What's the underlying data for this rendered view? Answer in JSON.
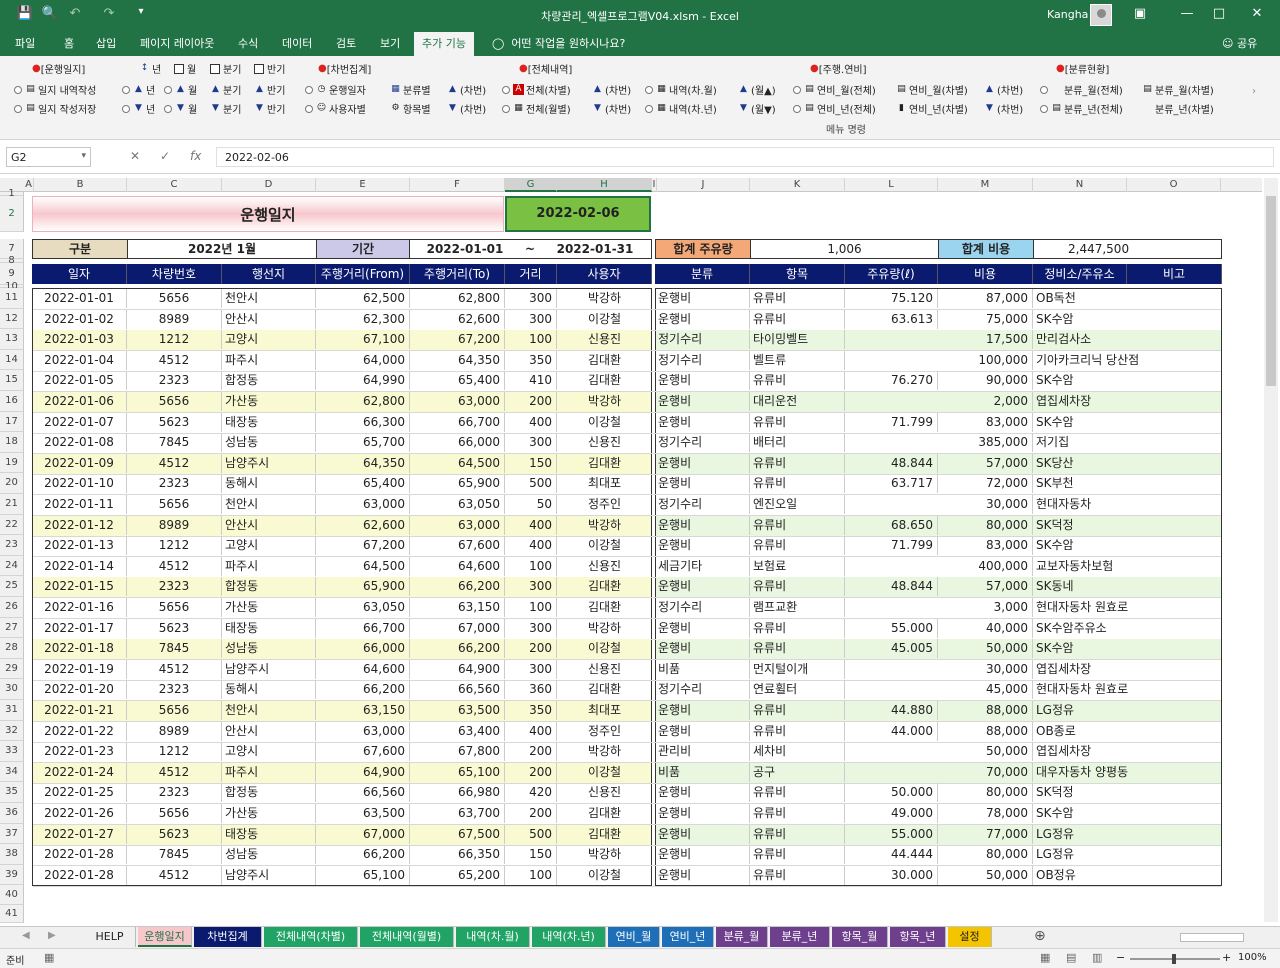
{
  "window": {
    "title": "차량관리_엑셀프로그램V04.xlsm  -  Excel",
    "user": "Kangha"
  },
  "tabs": [
    "파일",
    "홈",
    "삽입",
    "페이지 레이아웃",
    "수식",
    "데이터",
    "검토",
    "보기",
    "추가 기능"
  ],
  "tell_me": "어떤 작업을 원하시나요?",
  "share": "공유",
  "ribbon": {
    "row1": [
      "[운행일지]",
      "년",
      "월",
      "분기",
      "반기",
      "[차번집계]",
      "[전체내역]",
      "[주행.연비]",
      "[분류현황]"
    ],
    "row2": [
      "일지 내역작성",
      "년",
      "월",
      "분기",
      "반기",
      "운행일자",
      "분류별",
      "(차번)",
      "전체(차별)",
      "(차번)",
      "내역(차.월)",
      "(월▲)",
      "연비_월(전체)",
      "연비_월(차별)",
      "(차번)",
      "분류_월(전체)",
      "분류_월(차별)"
    ],
    "row3": [
      "일지 작성저장",
      "년",
      "월",
      "분기",
      "반기",
      "사용자별",
      "항목별",
      "(차번)",
      "전체(월별)",
      "(차번)",
      "내역(차.년)",
      "(월▼)",
      "연비_년(전체)",
      "연비_년(차별)",
      "(차번)",
      "분류_년(전체)",
      "분류_년(차별)"
    ],
    "group": "메뉴 명령"
  },
  "formula_bar": {
    "name_box": "G2",
    "formula": "2022-02-06"
  },
  "columns": [
    "A",
    "B",
    "C",
    "D",
    "E",
    "F",
    "G",
    "H",
    "I",
    "J",
    "K",
    "L",
    "M",
    "N",
    "O"
  ],
  "row_numbers": [
    "1",
    "2",
    "7",
    "8",
    "9",
    "10",
    "11",
    "12",
    "13",
    "14",
    "15",
    "16",
    "17",
    "18",
    "19",
    "20",
    "21",
    "22",
    "23",
    "24",
    "25",
    "26",
    "27",
    "28",
    "29",
    "30",
    "31",
    "32",
    "33",
    "34",
    "35",
    "36",
    "37",
    "38",
    "39",
    "40",
    "41"
  ],
  "sheet": {
    "title": "운행일지",
    "date": "2022-02-06",
    "gubun_label": "구분",
    "gubun_value": "2022년 1월",
    "period_label": "기간",
    "period_from": "2022-01-01",
    "tilde": "~",
    "period_to": "2022-01-31",
    "fuel_label": "합계 주유량",
    "fuel_value": "1,006",
    "cost_label": "합계 비용",
    "cost_value": "2,447,500",
    "left_headers": [
      "일자",
      "차량번호",
      "행선지",
      "주행거리(From)",
      "주행거리(To)",
      "거리",
      "사용자"
    ],
    "right_headers": [
      "분류",
      "항목",
      "주유량(ℓ)",
      "비용",
      "정비소/주유소",
      "비고"
    ],
    "rows": [
      [
        "2022-01-01",
        "5656",
        "천안시",
        "62,500",
        "62,800",
        "300",
        "박강하",
        "운행비",
        "유류비",
        "75.120",
        "87,000",
        "OB독천"
      ],
      [
        "2022-01-02",
        "8989",
        "안산시",
        "62,300",
        "62,600",
        "300",
        "이강철",
        "운행비",
        "유류비",
        "63.613",
        "75,000",
        "SK수암"
      ],
      [
        "2022-01-03",
        "1212",
        "고양시",
        "67,100",
        "67,200",
        "100",
        "신용진",
        "정기수리",
        "타이밍벨트",
        "",
        "17,500",
        "만리검사소"
      ],
      [
        "2022-01-04",
        "4512",
        "파주시",
        "64,000",
        "64,350",
        "350",
        "김대환",
        "정기수리",
        "벨트류",
        "",
        "100,000",
        "기아카크리닉 당산점"
      ],
      [
        "2022-01-05",
        "2323",
        "합정동",
        "64,990",
        "65,400",
        "410",
        "김대환",
        "운행비",
        "유류비",
        "76.270",
        "90,000",
        "SK수암"
      ],
      [
        "2022-01-06",
        "5656",
        "가산동",
        "62,800",
        "63,000",
        "200",
        "박강하",
        "운행비",
        "대리운전",
        "",
        "2,000",
        "엽집세차장"
      ],
      [
        "2022-01-07",
        "5623",
        "태장동",
        "66,300",
        "66,700",
        "400",
        "이강철",
        "운행비",
        "유류비",
        "71.799",
        "83,000",
        "SK수암"
      ],
      [
        "2022-01-08",
        "7845",
        "성남동",
        "65,700",
        "66,000",
        "300",
        "신용진",
        "정기수리",
        "배터리",
        "",
        "385,000",
        "저기집"
      ],
      [
        "2022-01-09",
        "4512",
        "남양주시",
        "64,350",
        "64,500",
        "150",
        "김대환",
        "운행비",
        "유류비",
        "48.844",
        "57,000",
        "SK당산"
      ],
      [
        "2022-01-10",
        "2323",
        "동해시",
        "65,400",
        "65,900",
        "500",
        "최대포",
        "운행비",
        "유류비",
        "63.717",
        "72,000",
        "SK부천"
      ],
      [
        "2022-01-11",
        "5656",
        "천안시",
        "63,000",
        "63,050",
        "50",
        "정주인",
        "정기수리",
        "엔진오일",
        "",
        "30,000",
        "현대자동차"
      ],
      [
        "2022-01-12",
        "8989",
        "안산시",
        "62,600",
        "63,000",
        "400",
        "박강하",
        "운행비",
        "유류비",
        "68.650",
        "80,000",
        "SK덕정"
      ],
      [
        "2022-01-13",
        "1212",
        "고양시",
        "67,200",
        "67,600",
        "400",
        "이강철",
        "운행비",
        "유류비",
        "71.799",
        "83,000",
        "SK수암"
      ],
      [
        "2022-01-14",
        "4512",
        "파주시",
        "64,500",
        "64,600",
        "100",
        "신용진",
        "세금기타",
        "보험료",
        "",
        "400,000",
        "교보자동차보험"
      ],
      [
        "2022-01-15",
        "2323",
        "합정동",
        "65,900",
        "66,200",
        "300",
        "김대환",
        "운행비",
        "유류비",
        "48.844",
        "57,000",
        "SK동네"
      ],
      [
        "2022-01-16",
        "5656",
        "가산동",
        "63,050",
        "63,150",
        "100",
        "김대환",
        "정기수리",
        "램프교환",
        "",
        "3,000",
        "현대자동차 원효로"
      ],
      [
        "2022-01-17",
        "5623",
        "태장동",
        "66,700",
        "67,000",
        "300",
        "박강하",
        "운행비",
        "유류비",
        "55.000",
        "40,000",
        "SK수암주유소"
      ],
      [
        "2022-01-18",
        "7845",
        "성남동",
        "66,000",
        "66,200",
        "200",
        "이강철",
        "운행비",
        "유류비",
        "45.005",
        "50,000",
        "SK수암"
      ],
      [
        "2022-01-19",
        "4512",
        "남양주시",
        "64,600",
        "64,900",
        "300",
        "신용진",
        "비품",
        "먼지털이개",
        "",
        "30,000",
        "엽집세차장"
      ],
      [
        "2022-01-20",
        "2323",
        "동해시",
        "66,200",
        "66,560",
        "360",
        "김대환",
        "정기수리",
        "연료휠터",
        "",
        "45,000",
        "현대자동차 원효로"
      ],
      [
        "2022-01-21",
        "5656",
        "천안시",
        "63,150",
        "63,500",
        "350",
        "최대포",
        "운행비",
        "유류비",
        "44.880",
        "88,000",
        "LG정유"
      ],
      [
        "2022-01-22",
        "8989",
        "안산시",
        "63,000",
        "63,400",
        "400",
        "정주인",
        "운행비",
        "유류비",
        "44.000",
        "88,000",
        "OB종로"
      ],
      [
        "2022-01-23",
        "1212",
        "고양시",
        "67,600",
        "67,800",
        "200",
        "박강하",
        "관리비",
        "세차비",
        "",
        "50,000",
        "엽집세차장"
      ],
      [
        "2022-01-24",
        "4512",
        "파주시",
        "64,900",
        "65,100",
        "200",
        "이강철",
        "비품",
        "공구",
        "",
        "70,000",
        "대우자동차 양평동"
      ],
      [
        "2022-01-25",
        "2323",
        "합정동",
        "66,560",
        "66,980",
        "420",
        "신용진",
        "운행비",
        "유류비",
        "50.000",
        "80,000",
        "SK덕정"
      ],
      [
        "2022-01-26",
        "5656",
        "가산동",
        "63,500",
        "63,700",
        "200",
        "김대환",
        "운행비",
        "유류비",
        "49.000",
        "78,000",
        "SK수암"
      ],
      [
        "2022-01-27",
        "5623",
        "태장동",
        "67,000",
        "67,500",
        "500",
        "김대환",
        "운행비",
        "유류비",
        "55.000",
        "77,000",
        "LG정유"
      ],
      [
        "2022-01-28",
        "7845",
        "성남동",
        "66,200",
        "66,350",
        "150",
        "박강하",
        "운행비",
        "유류비",
        "44.444",
        "80,000",
        "LG정유"
      ],
      [
        "2022-01-28",
        "4512",
        "남양주시",
        "65,100",
        "65,200",
        "100",
        "이강철",
        "운행비",
        "유류비",
        "30.000",
        "50,000",
        "OB정유"
      ]
    ]
  },
  "sheet_tabs": [
    "HELP",
    "운행일지",
    "차번집계",
    "전체내역(차별)",
    "전체내역(월별)",
    "내역(차.월)",
    "내역(차.년)",
    "연비_월",
    "연비_년",
    "분류_월",
    "분류_년",
    "항목_월",
    "항목_년",
    "설정"
  ],
  "sheet_tab_colors": [
    "#f0f0f0",
    "#f7c7cc",
    "#0a1a6e",
    "#21a366",
    "#21a366",
    "#21a366",
    "#21a366",
    "#1e6fb8",
    "#1e6fb8",
    "#6d3f8c",
    "#6d3f8c",
    "#6d3f8c",
    "#6d3f8c",
    "#f5c400"
  ],
  "status": {
    "ready": "준비",
    "zoom": "100%"
  }
}
